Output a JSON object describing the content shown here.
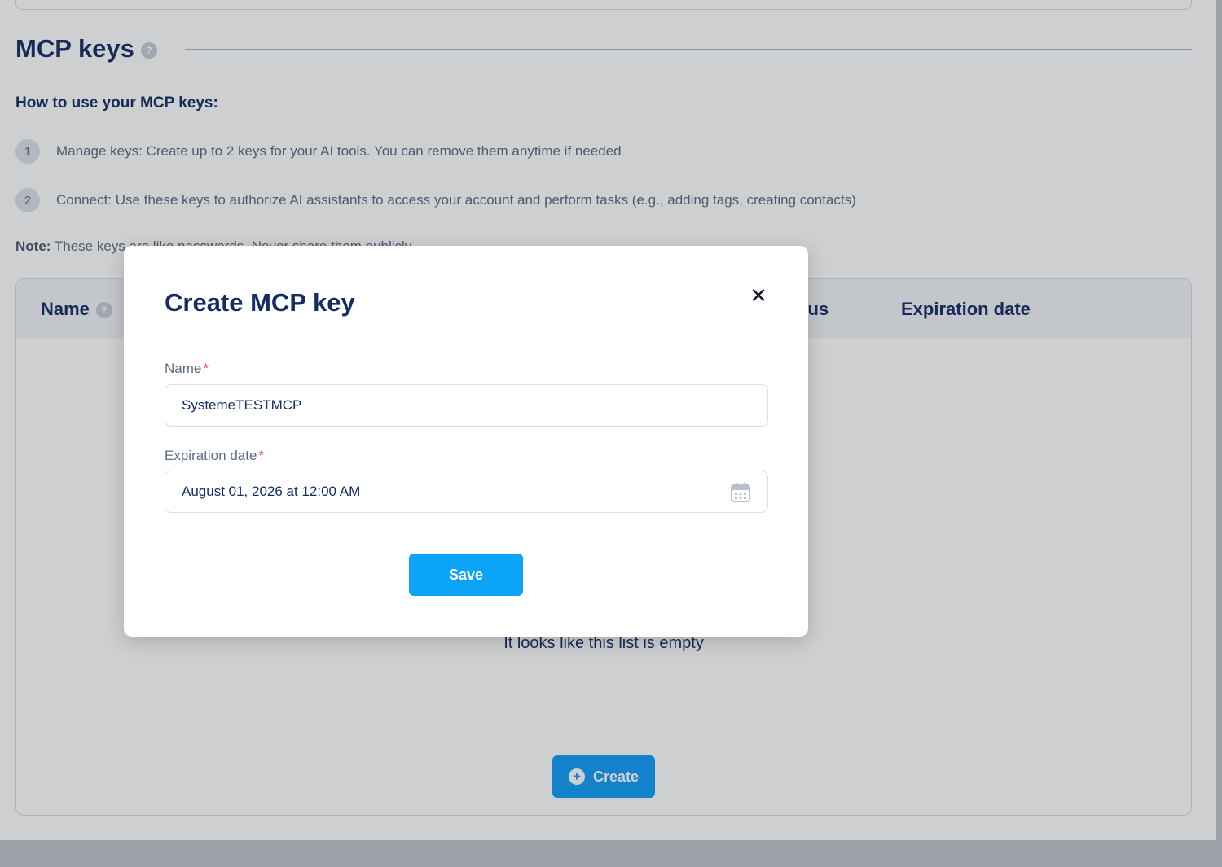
{
  "section": {
    "title": "MCP keys",
    "help_glyph": "?",
    "howto_title": "How to use your MCP keys:",
    "steps": [
      {
        "num": "1",
        "text": "Manage keys: Create up to 2 keys for your AI tools. You can remove them anytime if needed"
      },
      {
        "num": "2",
        "text": "Connect: Use these keys to authorize AI assistants to access your account and perform tasks (e.g., adding tags, creating contacts)"
      }
    ],
    "note_label": "Note:",
    "note_text": " These keys are like passwords. Never share them publicly."
  },
  "table": {
    "columns": [
      "Name",
      "Status",
      "Expiration date"
    ],
    "empty_text": "It looks like this list is empty",
    "create_label": "Create"
  },
  "modal": {
    "title": "Create MCP key",
    "close_glyph": "✕",
    "name_label": "Name",
    "name_value": "SystemeTESTMCP",
    "expiration_label": "Expiration date",
    "expiration_value": "August 01, 2026 at 12:00 AM",
    "required_mark": "*",
    "save_label": "Save"
  },
  "colors": {
    "accent": "#0ba4f6",
    "heading": "#142d63",
    "required": "#f0436f"
  }
}
